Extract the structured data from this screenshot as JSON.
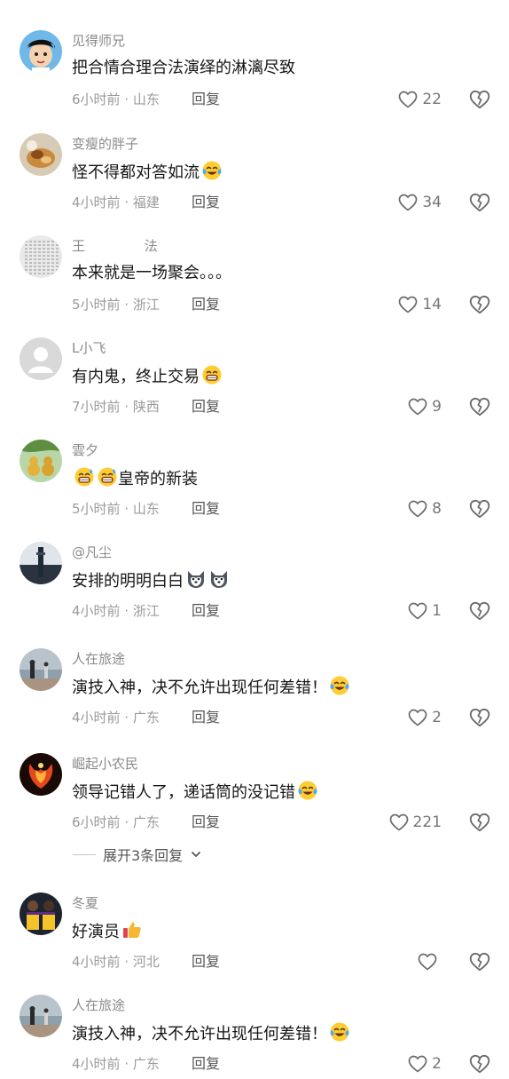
{
  "comments": [
    {
      "user": "见得师兄",
      "text": "把合情合理合法演绎的淋漓尽致",
      "emoji": "",
      "time": "6小时前",
      "region": "山东",
      "reply": "回复",
      "likes": "22",
      "avatar": "cartoon-boy"
    },
    {
      "user": "变瘦的胖子",
      "text": "怪不得都对答如流",
      "emoji": "cry-laugh",
      "time": "4小时前",
      "region": "福建",
      "reply": "回复",
      "likes": "34",
      "avatar": "food"
    },
    {
      "user": "王              法",
      "text": "本来就是一场聚会。。。",
      "emoji": "",
      "time": "5小时前",
      "region": "浙江",
      "reply": "回复",
      "likes": "14",
      "avatar": "calligraphy"
    },
    {
      "user": "L小飞",
      "text": "有内鬼，终止交易",
      "emoji": "grin",
      "time": "7小时前",
      "region": "陕西",
      "reply": "回复",
      "likes": "9",
      "avatar": "default-user"
    },
    {
      "user": "雲夕",
      "text": "皇帝的新装",
      "emoji_prefix": "grin-sweat-2",
      "emoji": "",
      "time": "5小时前",
      "region": "山东",
      "reply": "回复",
      "likes": "8",
      "avatar": "gourds"
    },
    {
      "user": "@凡尘",
      "text": "安排的明明白白",
      "emoji": "husky-2",
      "time": "4小时前",
      "region": "浙江",
      "reply": "回复",
      "likes": "1",
      "avatar": "tower"
    },
    {
      "user": "人在旅途",
      "text": "演技入神，决不允许出现任何差错！",
      "emoji": "cry-laugh",
      "time": "4小时前",
      "region": "广东",
      "reply": "回复",
      "likes": "2",
      "avatar": "beach"
    },
    {
      "user": "崛起小农民",
      "text": "领导记错人了，递话筒的没记错",
      "emoji": "cry-laugh",
      "time": "6小时前",
      "region": "广东",
      "reply": "回复",
      "likes": "221",
      "avatar": "phoenix"
    },
    {
      "user": "冬夏",
      "text": "好演员",
      "emoji": "thumbs-up",
      "time": "4小时前",
      "region": "河北",
      "reply": "回复",
      "likes": "",
      "avatar": "players"
    },
    {
      "user": "人在旅途",
      "text": "演技入神，决不允许出现任何差错！",
      "emoji": "cry-laugh",
      "time": "4小时前",
      "region": "广东",
      "reply": "回复",
      "likes": "2",
      "avatar": "beach"
    }
  ],
  "expand_replies": "展开3条回复",
  "colors": {
    "text": "#161616",
    "muted": "#9a9a9a",
    "icon": "#6b6b6b"
  }
}
